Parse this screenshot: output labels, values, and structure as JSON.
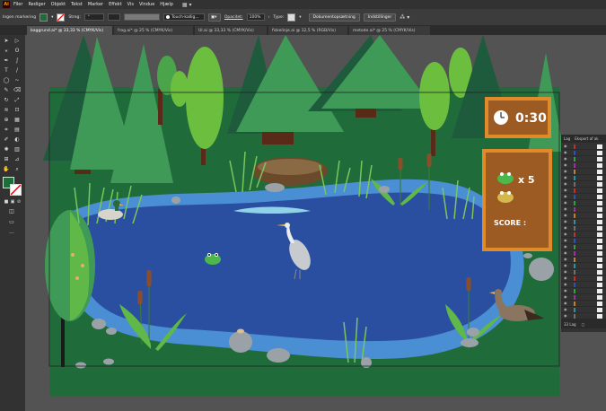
{
  "menubar": {
    "app_logo": "Ai",
    "items": [
      "Filer",
      "Rediger",
      "Objekt",
      "Tekst",
      "Marker",
      "Effekt",
      "Vis",
      "Vindue",
      "Hjælp"
    ]
  },
  "controlbar": {
    "selection_label": "Ingen markering",
    "stroke_label": "Streg:",
    "brush_label": "Touch-kallig...",
    "opacity_label": "Opacitet:",
    "opacity_value": "100%",
    "type_label": "Type:",
    "doc_setup_button": "Dokumentopsætning",
    "prefs_button": "Indstillinger",
    "fill_color": "#1f6b3a"
  },
  "tabs": [
    {
      "label": "baggrund.ai* @ 33,33 % (CMYK/Vis)",
      "active": true
    },
    {
      "label": "frog.ai* @ 25 % (CMYK/Vis)",
      "active": false
    },
    {
      "label": "UI.ai @ 33,33 % (CMYK/Vis)",
      "active": false
    },
    {
      "label": "fiskelinje.ai @ 12,5 % (RGB/Vis)",
      "active": false
    },
    {
      "label": "metode.ai* @ 25 % (CMYK/Vis)",
      "active": false
    }
  ],
  "game": {
    "timer": "0:30",
    "multiplier": "x 5",
    "score_label": "SCORE :"
  },
  "layers_panel": {
    "tab_layers": "Lag",
    "tab_export": "Eksport af ak",
    "footer": "33 Lag"
  },
  "colors": {
    "grass": "#1f6b3a",
    "water": "#2b4fa0",
    "water_edge": "#4a8fd4",
    "tree_dark": "#1e5a3c",
    "tree_mid": "#3f9a57",
    "panel_wood": "#9b5b22",
    "panel_border": "#e08a2a"
  }
}
